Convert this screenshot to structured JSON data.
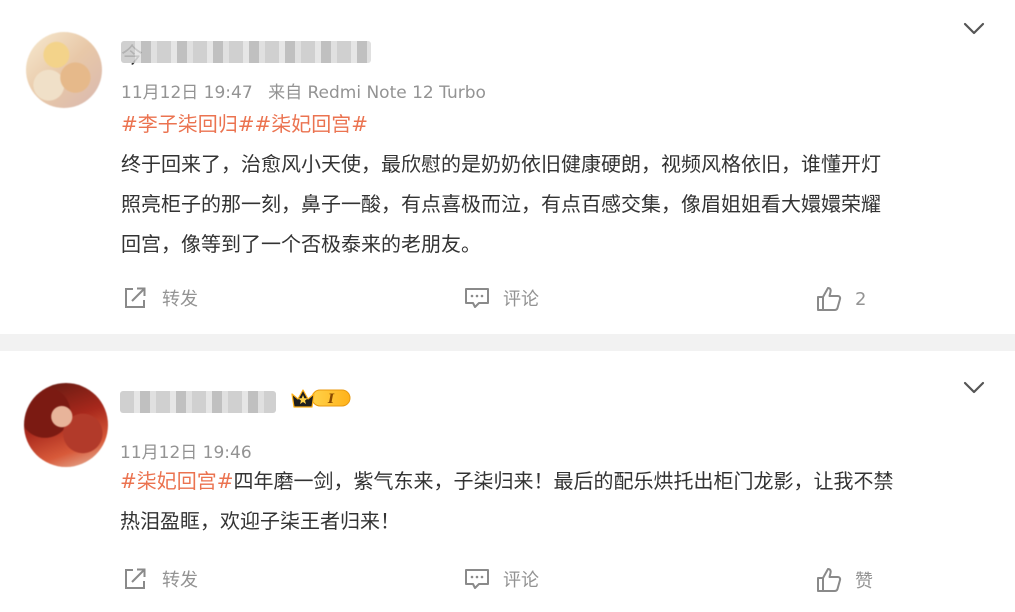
{
  "posts": [
    {
      "author_prefix": "今",
      "meta": {
        "date": "11月12日 19:47",
        "source": "来自 Redmi Note 12 Turbo"
      },
      "hashtags": [
        "#李子柒回归#",
        "#柒妃回宫#"
      ],
      "body_lines": [
        "终于回来了，治愈风小天使，最欣慰的是奶奶依旧健康硬朗，视频风格依旧，谁懂开灯",
        "照亮柜子的那一刻，鼻子一酸，有点喜极而泣，有点百感交集，像眉姐姐看大嬛嬛荣耀",
        "回宫，像等到了一个否极泰来的老朋友。"
      ],
      "actions": {
        "repost": "转发",
        "comment": "评论",
        "like": "2"
      }
    },
    {
      "vip_badge_text": "I",
      "meta": {
        "date": "11月12日 19:46"
      },
      "hashtags": [
        "#柒妃回宫#"
      ],
      "body_line_1_rest": "四年磨一剑，紫气东来，子柒归来！最后的配乐烘托出柜门龙影，让我不禁",
      "body_line_2": "热泪盈眶，欢迎子柒王者归来！",
      "actions": {
        "repost": "转发",
        "comment": "评论",
        "like": "赞"
      }
    }
  ],
  "colors": {
    "hashtag": "#eb7350",
    "meta": "#939393",
    "text": "#333333",
    "divider": "#f2f2f2"
  },
  "icons": {
    "expand": "chevron-down-icon",
    "repost": "share-arrow-icon",
    "comment": "comment-bubble-icon",
    "like": "thumbs-up-icon",
    "vip": "crown-badge-icon"
  }
}
